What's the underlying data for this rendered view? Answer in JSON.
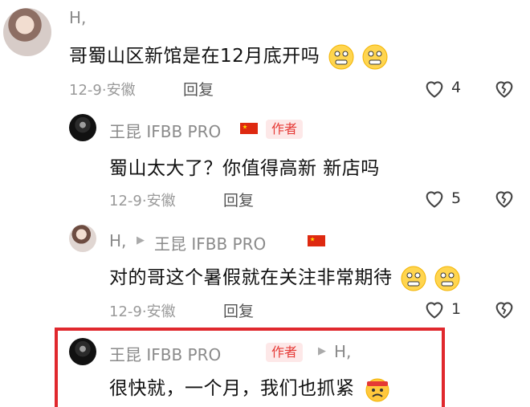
{
  "comments": [
    {
      "name": "H,",
      "text": "哥蜀山区新馆是在12月底开吗",
      "date": "12-9·安徽",
      "reply": "回复",
      "likes": "4",
      "emoji": [
        "grimace",
        "grimace"
      ]
    },
    {
      "name": "王昆 IFBB PRO",
      "badge": "作者",
      "text": "蜀山太大了？你值得高新 新店吗",
      "date": "12-9·安徽",
      "reply": "回复",
      "likes": "5"
    },
    {
      "name": "H,",
      "reply_to": "王昆 IFBB PRO",
      "text": "对的哥这个暑假就在关注非常期待",
      "date": "12-9·安徽",
      "reply": "回复",
      "likes": "1",
      "emoji": [
        "grimace",
        "grimace"
      ]
    },
    {
      "name": "王昆 IFBB PRO",
      "badge": "作者",
      "reply_to": "H,",
      "text": "很快就，一个月，我们也抓紧",
      "emoji": [
        "headband"
      ]
    }
  ],
  "colors": {
    "highlight": "#e0282d",
    "badge_text": "#e53935",
    "badge_bg": "#fde8e8"
  },
  "icons": [
    "heart-outline-icon",
    "broken-heart-icon",
    "china-flag-icon",
    "reply-arrow-icon"
  ]
}
